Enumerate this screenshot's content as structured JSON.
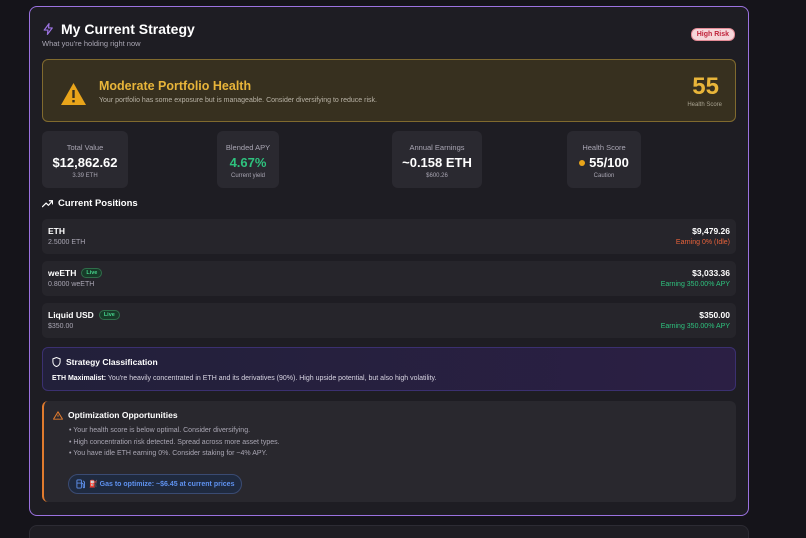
{
  "header": {
    "title": "My Current Strategy",
    "subtitle": "What you're holding right now",
    "risk_badge": "High Risk"
  },
  "health": {
    "title": "Moderate Portfolio Health",
    "message": "Your portfolio has some exposure but is manageable. Consider diversifying to reduce risk.",
    "score": "55",
    "score_label": "Health Score"
  },
  "stats": [
    {
      "label": "Total Value",
      "value": "$12,862.62",
      "sub": "3.39 ETH"
    },
    {
      "label": "Blended APY",
      "value": "4.67%",
      "sub": "Current yield"
    },
    {
      "label": "Annual Earnings",
      "value": "~0.158 ETH",
      "sub": "$600.26"
    },
    {
      "label": "Health Score",
      "value": "55/100",
      "sub": "Caution"
    }
  ],
  "positions_title": "Current Positions",
  "positions": [
    {
      "name": "ETH",
      "amount": "2.5000 ETH",
      "usd": "$9,479.26",
      "earning": "Earning 0% (Idle)",
      "live": ""
    },
    {
      "name": "weETH",
      "amount": "0.8000 weETH",
      "usd": "$3,033.36",
      "earning": "Earning 350.00% APY",
      "live": "Live"
    },
    {
      "name": "Liquid USD",
      "amount": "$350.00",
      "usd": "$350.00",
      "earning": "Earning 350.00% APY",
      "live": "Live"
    }
  ],
  "strategy": {
    "title": "Strategy Classification",
    "label": "ETH Maximalist:",
    "text": " You're heavily concentrated in ETH and its derivatives (90%). High upside potential, but also high volatility."
  },
  "optimization": {
    "title": "Optimization Opportunities",
    "items": [
      "• Your health score is below optimal. Consider diversifying.",
      "• High concentration risk detected. Spread across more asset types.",
      "• You have idle ETH earning 0%. Consider staking for ~4% APY."
    ],
    "gas": "⛽ Gas to optimize: ~$6.45 at current prices"
  },
  "colors": {
    "accent": "#9b72e0",
    "warning": "#e8b53a",
    "positive": "#2ec27e",
    "negative": "#e8623a"
  }
}
